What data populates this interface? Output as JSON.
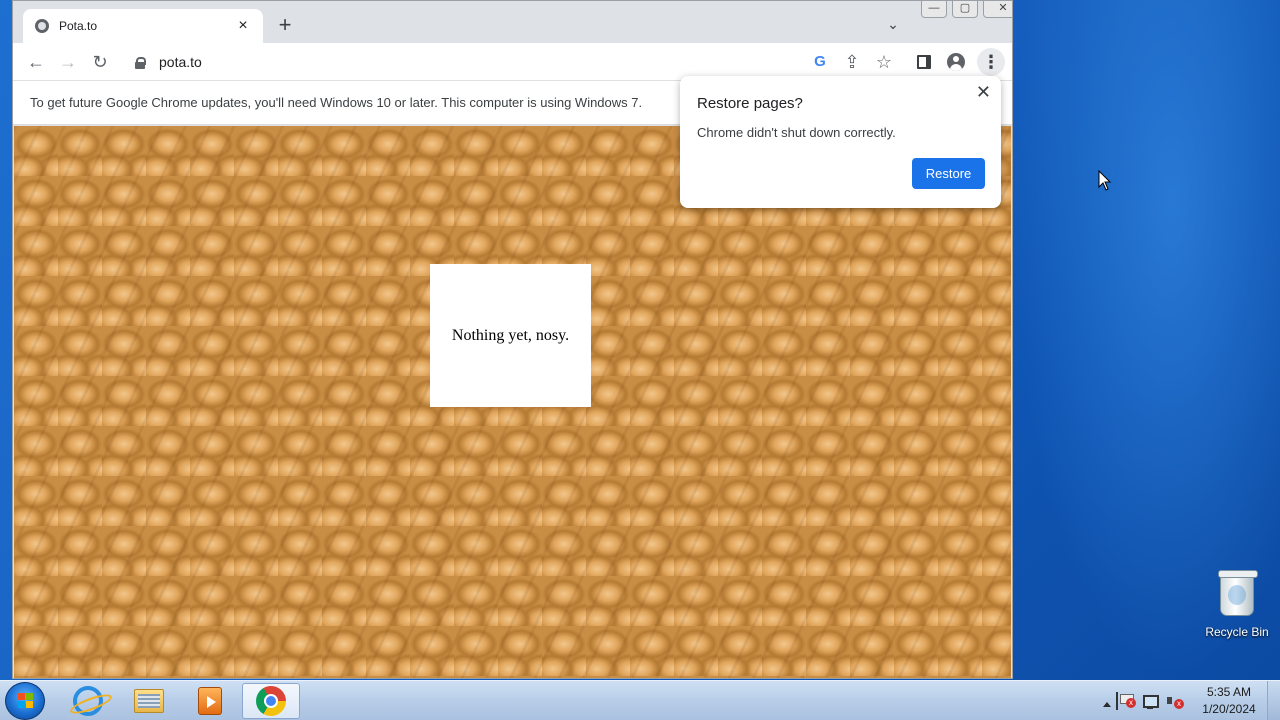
{
  "browser": {
    "tab": {
      "title": "Pota.to",
      "favicon": "globe-icon",
      "close_glyph": "×"
    },
    "new_tab_glyph": "+",
    "tab_search_glyph": "⌄",
    "window_buttons": {
      "minimize": "—",
      "maximize": "▢",
      "close": "✕"
    },
    "toolbar": {
      "back_glyph": "←",
      "forward_glyph": "→",
      "reload_glyph": "↻",
      "url": "pota.to",
      "google_glyph": "G",
      "share_glyph": "⇪",
      "bookmark_glyph": "☆",
      "menu_glyph": "⋮"
    },
    "infobar_text": "To get future Google Chrome updates, you'll need Windows 10 or later. This computer is using Windows 7."
  },
  "page": {
    "notice": "Nothing yet, nosy."
  },
  "restore_bubble": {
    "title": "Restore pages?",
    "message": "Chrome didn't shut down correctly.",
    "button": "Restore",
    "close_glyph": "✕",
    "accent": "#1a73e8"
  },
  "desktop": {
    "recycle_bin_label": "Recycle Bin"
  },
  "taskbar": {
    "items": [
      "internet-explorer",
      "file-explorer",
      "media-player",
      "google-chrome"
    ],
    "clock_time": "5:35 AM",
    "clock_date": "1/20/2024"
  }
}
